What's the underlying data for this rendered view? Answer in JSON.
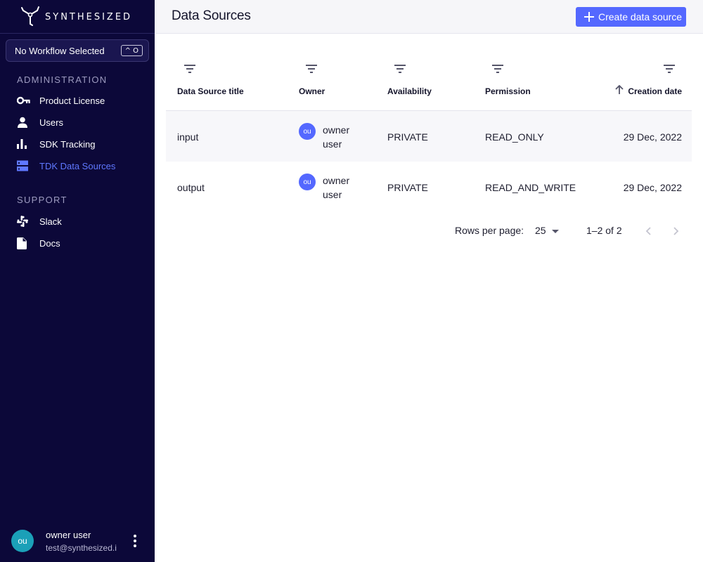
{
  "app": {
    "logo_text": "SYNTHESIZED"
  },
  "sidebar": {
    "workflow_selector": {
      "label": "No Workflow Selected",
      "shortcut": "^ O"
    },
    "sections": [
      {
        "title": "ADMINISTRATION",
        "items": [
          {
            "label": "Product License",
            "icon": "key-icon",
            "active": false
          },
          {
            "label": "Users",
            "icon": "user-icon",
            "active": false
          },
          {
            "label": "SDK Tracking",
            "icon": "bar-chart-icon",
            "active": false
          },
          {
            "label": "TDK Data Sources",
            "icon": "storage-icon",
            "active": true
          }
        ]
      },
      {
        "title": "SUPPORT",
        "items": [
          {
            "label": "Slack",
            "icon": "slack-icon",
            "active": false
          },
          {
            "label": "Docs",
            "icon": "document-icon",
            "active": false
          }
        ]
      }
    ],
    "user": {
      "initials": "ou",
      "name": "owner user",
      "email": "test@synthesized.i"
    }
  },
  "header": {
    "title": "Data Sources",
    "create_button": "Create data source"
  },
  "table": {
    "columns": [
      "Data Source title",
      "Owner",
      "Availability",
      "Permission",
      "Creation date"
    ],
    "sort": {
      "column": "Creation date",
      "direction": "ascending"
    },
    "rows": [
      {
        "title": "input",
        "owner_initials": "ou",
        "owner_first": "owner",
        "owner_last": "user",
        "availability": "PRIVATE",
        "permission": "READ_ONLY",
        "created": "29 Dec, 2022"
      },
      {
        "title": "output",
        "owner_initials": "ou",
        "owner_first": "owner",
        "owner_last": "user",
        "availability": "PRIVATE",
        "permission": "READ_AND_WRITE",
        "created": "29 Dec, 2022"
      }
    ]
  },
  "pagination": {
    "rows_per_page_label": "Rows per page:",
    "rows_per_page": "25",
    "range": "1–2 of 2"
  },
  "colors": {
    "sidebar_bg": "#0c0839",
    "accent": "#5468ff",
    "active_nav": "#5f78ff",
    "user_avatar": "#1ba0b8"
  }
}
